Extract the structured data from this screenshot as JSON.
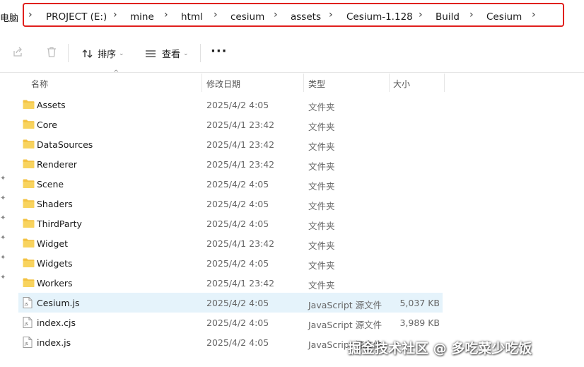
{
  "address": {
    "root_label": "电脑",
    "crumbs": [
      "PROJECT (E:)",
      "mine",
      "html",
      "cesium",
      "assets",
      "Cesium-1.128",
      "Build",
      "Cesium"
    ]
  },
  "toolbar": {
    "share_icon": "share-icon",
    "delete_icon": "trash-icon",
    "sort_label": "排序",
    "view_label": "查看",
    "more_label": "···"
  },
  "columns": {
    "name": "名称",
    "date": "修改日期",
    "type": "类型",
    "size": "大小"
  },
  "files": [
    {
      "name": "Assets",
      "date": "2025/4/2 4:05",
      "type": "文件夹",
      "size": "",
      "kind": "folder"
    },
    {
      "name": "Core",
      "date": "2025/4/1 23:42",
      "type": "文件夹",
      "size": "",
      "kind": "folder"
    },
    {
      "name": "DataSources",
      "date": "2025/4/1 23:42",
      "type": "文件夹",
      "size": "",
      "kind": "folder"
    },
    {
      "name": "Renderer",
      "date": "2025/4/1 23:42",
      "type": "文件夹",
      "size": "",
      "kind": "folder"
    },
    {
      "name": "Scene",
      "date": "2025/4/2 4:05",
      "type": "文件夹",
      "size": "",
      "kind": "folder"
    },
    {
      "name": "Shaders",
      "date": "2025/4/2 4:05",
      "type": "文件夹",
      "size": "",
      "kind": "folder"
    },
    {
      "name": "ThirdParty",
      "date": "2025/4/2 4:05",
      "type": "文件夹",
      "size": "",
      "kind": "folder"
    },
    {
      "name": "Widget",
      "date": "2025/4/1 23:42",
      "type": "文件夹",
      "size": "",
      "kind": "folder"
    },
    {
      "name": "Widgets",
      "date": "2025/4/2 4:05",
      "type": "文件夹",
      "size": "",
      "kind": "folder"
    },
    {
      "name": "Workers",
      "date": "2025/4/1 23:42",
      "type": "文件夹",
      "size": "",
      "kind": "folder"
    },
    {
      "name": "Cesium.js",
      "date": "2025/4/2 4:05",
      "type": "JavaScript 源文件",
      "size": "5,037 KB",
      "kind": "file",
      "selected": true
    },
    {
      "name": "index.cjs",
      "date": "2025/4/2 4:05",
      "type": "JavaScript 源文件",
      "size": "3,989 KB",
      "kind": "file"
    },
    {
      "name": "index.js",
      "date": "2025/4/2 4:05",
      "type": "JavaScript 源文件",
      "size": "",
      "kind": "file"
    }
  ],
  "watermark": "掘金技术社区 @ 多吃菜少吃饭",
  "colors": {
    "highlight_border": "#e0201d",
    "folder_yellow": "#f3c242",
    "selected_row": "#e5f3fb"
  }
}
